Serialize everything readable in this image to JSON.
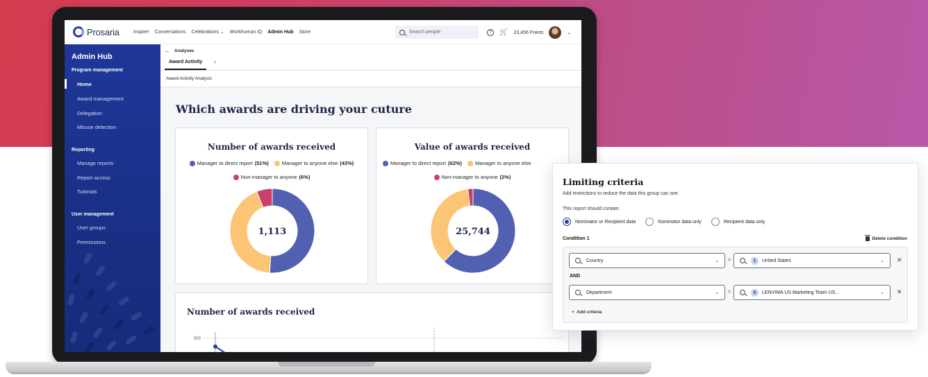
{
  "nav": {
    "logo_text": "Prosaria",
    "links": [
      "Inspire!",
      "Conversations",
      "Celebrations",
      "Workhuman iQ",
      "Admin Hub",
      "Store"
    ],
    "search_placeholder": "Search people",
    "points": "23,456 Points"
  },
  "sidebar": {
    "title": "Admin Hub",
    "sections": {
      "program": "Program management",
      "reporting": "Reporting",
      "users": "User management"
    },
    "items": {
      "home": "Home",
      "award_mgmt": "Award management",
      "delegation": "Delegation",
      "misuse": "Misuse detection",
      "manage_reports": "Manage reports",
      "report_access": "Report access",
      "tutorials": "Tutorials",
      "user_groups": "User groups",
      "permissions": "Permissions"
    }
  },
  "content": {
    "breadcrumb": "Analyses",
    "tab": "Award Activity",
    "tab_add": "+",
    "subheader": "Award Activity Analysis",
    "heading": "Which awards are driving your cuture",
    "chart2_title": "Number of awards received"
  },
  "chart_data": [
    {
      "type": "pie",
      "title": "Number of awards received",
      "center_label": "1,113",
      "categories": [
        "Manager to direct report",
        "Manager to anyone else",
        "Non-manager to anyone"
      ],
      "values": [
        51,
        43,
        6
      ],
      "value_labels": [
        "(51%)",
        "(43%)",
        "(6%)"
      ],
      "colors": [
        "#5160b0",
        "#fcc475",
        "#c93f6e"
      ]
    },
    {
      "type": "pie",
      "title": "Value of awards received",
      "center_label": "25,744",
      "categories": [
        "Manager to direct report",
        "Manager to anyone else",
        "Non-manager to anyone"
      ],
      "values": [
        62,
        36,
        2
      ],
      "value_labels": [
        "(62%)",
        "",
        "(2%)"
      ],
      "colors": [
        "#5160b0",
        "#fcc475",
        "#c93f6e"
      ]
    },
    {
      "type": "line",
      "title": "Number of awards received",
      "yticks": [
        "500"
      ]
    }
  ],
  "panel": {
    "title": "Limiting criteria",
    "subtitle": "Add restrictions to reduce the data this group can see.",
    "contain_label": "This report should contain:",
    "radio_options": [
      "Nominator or Recipient data",
      "Nominator data only",
      "Recipient data only"
    ],
    "condition_label": "Condition 1",
    "delete_label": "Delete condition",
    "row1": {
      "field": "Country",
      "op": "=",
      "count": "1",
      "value": "United States"
    },
    "and_label": "AND",
    "row2": {
      "field": "Department",
      "op": "=",
      "count": "5",
      "value": "LENVIMA US Marketing Team US..."
    },
    "add_label": "Add criteria"
  }
}
